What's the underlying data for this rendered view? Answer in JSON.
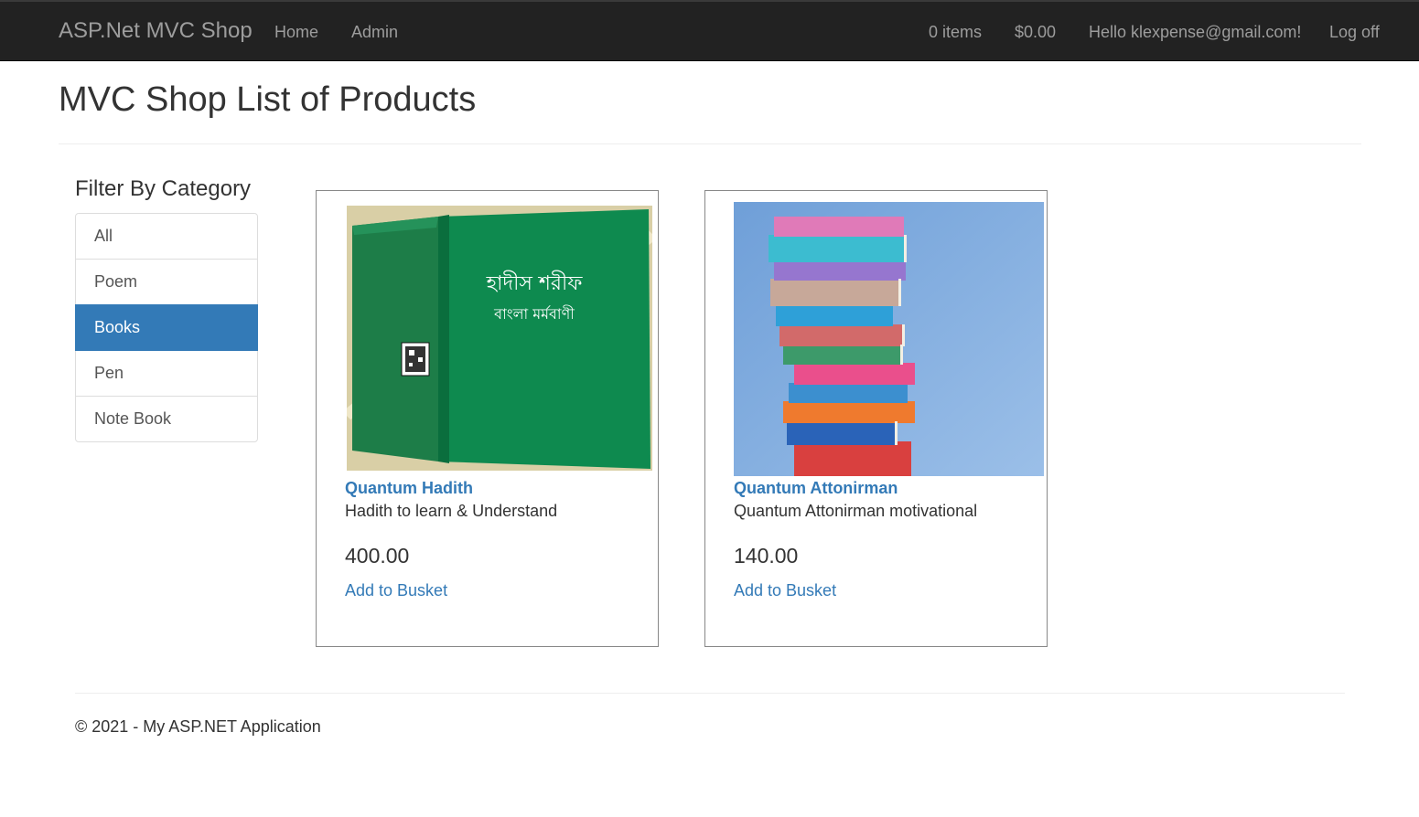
{
  "navbar": {
    "brand": "ASP.Net MVC Shop",
    "links": [
      "Home",
      "Admin"
    ],
    "basket_count": "0 items",
    "basket_total": "$0.00",
    "greeting": "Hello klexpense@gmail.com!",
    "logoff": "Log off"
  },
  "page": {
    "title": "MVC Shop List of Products"
  },
  "filter": {
    "heading": "Filter By Category",
    "categories": [
      {
        "label": "All",
        "active": false
      },
      {
        "label": "Poem",
        "active": false
      },
      {
        "label": "Books",
        "active": true
      },
      {
        "label": "Pen",
        "active": false
      },
      {
        "label": "Note Book",
        "active": false
      }
    ]
  },
  "products": [
    {
      "name": "Quantum Hadith",
      "description": "Hadith to learn & Understand",
      "price": "400.00",
      "add_label": "Add to Busket",
      "cover_text_line1": "হাদীস শরীফ",
      "cover_text_line2": "বাংলা মর্মবাণী"
    },
    {
      "name": "Quantum Attonirman",
      "description": "Quantum Attonirman motivational",
      "price": "140.00",
      "add_label": "Add to Busket"
    }
  ],
  "footer": {
    "text": "© 2021 - My ASP.NET Application"
  },
  "colors": {
    "navbar_bg": "#222222",
    "link": "#337ab7",
    "active_bg": "#337ab7"
  }
}
